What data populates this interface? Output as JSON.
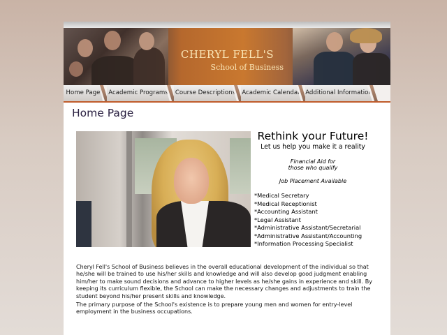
{
  "banner": {
    "title_line1": "CHERYL FELL'S",
    "title_line2": "School of Business"
  },
  "nav": {
    "tabs": [
      {
        "label": "Home Page"
      },
      {
        "label": "Academic Programs"
      },
      {
        "label": "Course Descriptions"
      },
      {
        "label": "Academic Calendar"
      },
      {
        "label": "Additional Information"
      }
    ]
  },
  "page": {
    "heading": "Home Page"
  },
  "promo": {
    "headline": "Rethink your Future!",
    "subheadline": "Let us help you make it a reality",
    "financial_aid_line1": "Financial Aid for",
    "financial_aid_line2": "those who qualify",
    "job_placement": "Job Placement Available",
    "services": [
      "*Medical Secretary",
      "*Medical Receptionist",
      "*Accounting Assistant",
      "*Legal Assistant",
      "*Administrative Assistant/Secretarial",
      "*Administrative Assistant/Accounting",
      "*Information Processing Specialist"
    ]
  },
  "body_text": {
    "paragraph1": "Cheryl Fell's School of Business believes in the overall educational development of the individual so that he/she will be trained to use his/her skills and knowledge and will also develop good judgment enabling him/her to make sound decisions and advance to higher levels as he/she gains in experience and skill.  By keeping its curriculum flexible, the School can make the necessary changes and adjustments to train the student beyond his/her present skills and knowledge.",
    "paragraph2": "The primary purpose of the School's existence is to prepare young men and women for entry-level employment in the business occupations."
  },
  "colors": {
    "accent": "#c05b2a",
    "heading": "#2b2142",
    "banner_text": "#fbe7b8"
  },
  "icons": {
    "banner_photo_left": "business-people-photo",
    "banner_photo_right": "business-team-photo",
    "main_photo": "smiling-businesswoman-photo"
  }
}
